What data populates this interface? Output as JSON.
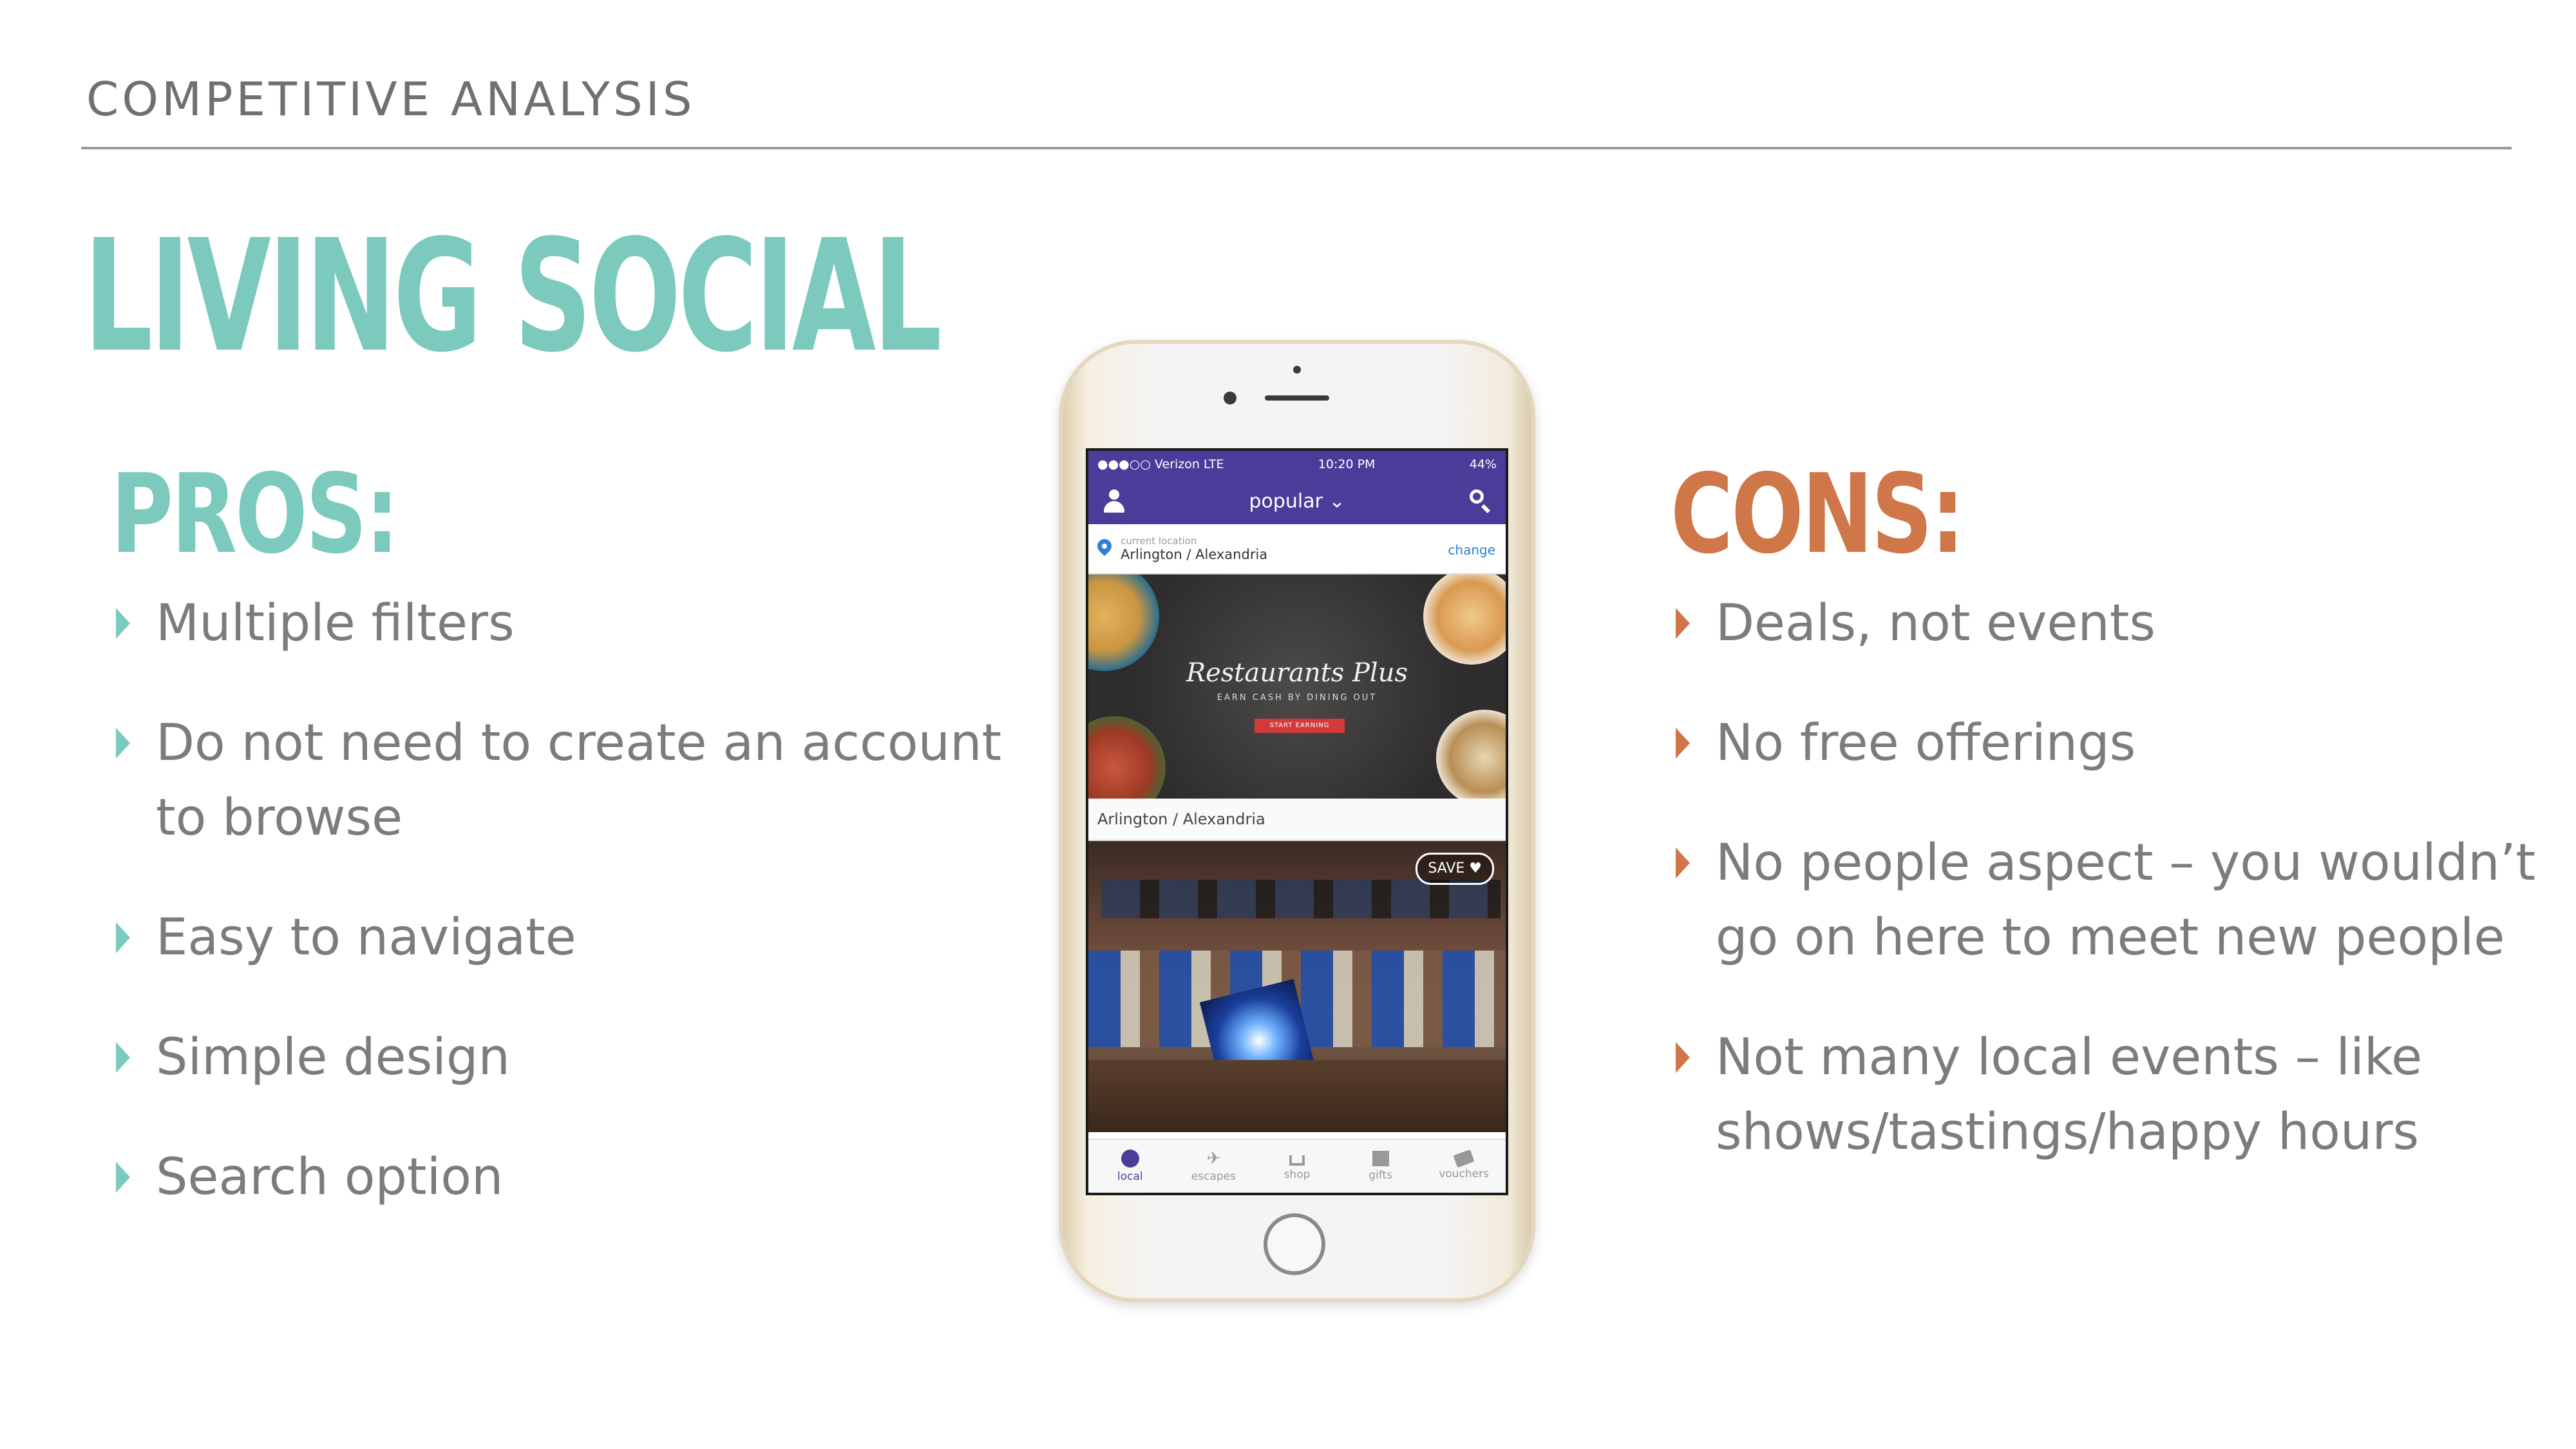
{
  "header": "COMPETITIVE ANALYSIS",
  "title": "LIVING SOCIAL",
  "pros": {
    "heading": "PROS:",
    "items": [
      "Multiple filters",
      "Do not need to create an account to browse",
      "Easy to navigate",
      "Simple design",
      "Search option"
    ]
  },
  "cons": {
    "heading": "CONS:",
    "items": [
      "Deals, not events",
      "No free offerings",
      "No people aspect – you wouldn’t go on here to meet new people",
      "Not many local events – like shows/tastings/happy hours"
    ]
  },
  "phone": {
    "status": {
      "carrier": "●●●○○ Verizon  LTE",
      "time": "10:20 PM",
      "battery": "44%"
    },
    "nav_title": "popular ⌄",
    "location_label": "current location",
    "location_value": "Arlington / Alexandria",
    "change_label": "change",
    "deal1": {
      "brand": "Restaurants Plus",
      "tagline": "EARN CASH BY DINING OUT",
      "cta": "START EARNING",
      "caption": "Arlington / Alexandria"
    },
    "save_label": "SAVE ♥",
    "tabs": [
      "local",
      "escapes",
      "shop",
      "gifts",
      "vouchers"
    ]
  },
  "colors": {
    "teal": "#7cc9bd",
    "orange": "#d0774a",
    "purple": "#4b3c9a"
  }
}
